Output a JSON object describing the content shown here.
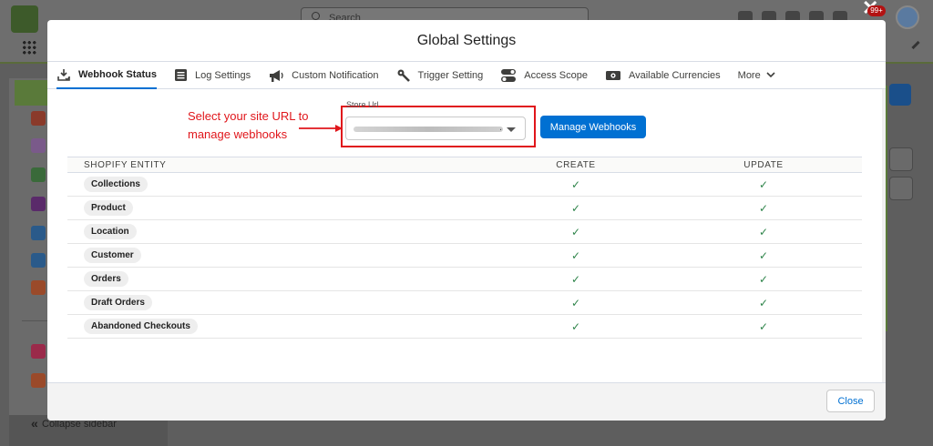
{
  "background": {
    "search_placeholder": "Search",
    "badge_count": "99+",
    "collapse_label": "Collapse sidebar"
  },
  "modal": {
    "title": "Global Settings",
    "tabs": [
      {
        "label": "Webhook Status",
        "icon": "download-check-icon",
        "active": true
      },
      {
        "label": "Log Settings",
        "icon": "list-icon",
        "active": false
      },
      {
        "label": "Custom Notification",
        "icon": "megaphone-icon",
        "active": false
      },
      {
        "label": "Trigger Setting",
        "icon": "wrench-icon",
        "active": false
      },
      {
        "label": "Access Scope",
        "icon": "toggle-icon",
        "active": false
      },
      {
        "label": "Available Currencies",
        "icon": "currency-icon",
        "active": false
      }
    ],
    "more_label": "More",
    "annotation": "Select your site URL to manage webhooks",
    "store_url": {
      "label": "Store Url",
      "value": "."
    },
    "manage_button": "Manage Webhooks",
    "table": {
      "headers": [
        "SHOPIFY ENTITY",
        "CREATE",
        "UPDATE"
      ],
      "rows": [
        {
          "entity": "Collections",
          "create": "✓",
          "update": "✓"
        },
        {
          "entity": "Product",
          "create": "✓",
          "update": "✓"
        },
        {
          "entity": "Location",
          "create": "✓",
          "update": "✓"
        },
        {
          "entity": "Customer",
          "create": "✓",
          "update": "✓"
        },
        {
          "entity": "Orders",
          "create": "✓",
          "update": "✓"
        },
        {
          "entity": "Draft Orders",
          "create": "✓",
          "update": "✓"
        },
        {
          "entity": "Abandoned Checkouts",
          "create": "✓",
          "update": "✓"
        }
      ]
    },
    "close_button": "Close"
  },
  "colors": {
    "accent": "#0070d2",
    "annotation": "#e0161b",
    "check": "#2e844a"
  }
}
